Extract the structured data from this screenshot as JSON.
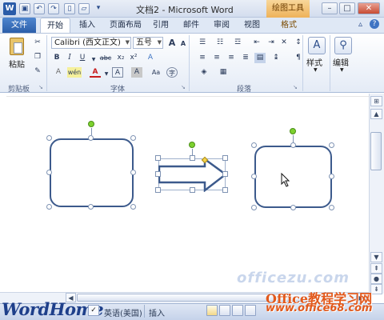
{
  "window": {
    "title": "文档2 - Microsoft Word",
    "contextual_tab": "绘图工具",
    "app_logo": "W",
    "quick_access": [
      "save-icon",
      "undo-icon",
      "redo-icon",
      "new-icon",
      "open-icon",
      "customize-icon"
    ],
    "controls": [
      "minimize",
      "maximize",
      "close"
    ]
  },
  "tabs": {
    "file": "文件",
    "home": "开始",
    "insert": "插入",
    "page_layout": "页面布局",
    "references": "引用",
    "mailings": "邮件",
    "review": "审阅",
    "view": "视图",
    "format": "格式"
  },
  "ribbon": {
    "clipboard": {
      "label": "剪贴板",
      "paste": "粘贴"
    },
    "font": {
      "label": "字体",
      "font_name": "Calibri (西文正文)",
      "font_size": "五号",
      "bold": "B",
      "italic": "I",
      "underline": "U",
      "strike": "abc",
      "subscript": "x₂",
      "superscript": "x²",
      "grow": "A",
      "shrink": "A",
      "case": "Aa",
      "clear": "A",
      "wen": "wén",
      "font_color": "A",
      "border_char": "A",
      "char_shading": "A",
      "enclose": "字"
    },
    "paragraph": {
      "label": "段落"
    },
    "styles": {
      "label": "样式"
    },
    "editing": {
      "label": "编辑"
    }
  },
  "statusbar": {
    "logo_text": "WordHome",
    "language": "英语(美国)",
    "insert_mode": "插入",
    "watermark_title": "Office教程学习网",
    "watermark_url": "www.office68.com",
    "watermark_faint": "officezu.com"
  },
  "colors": {
    "shape_outline": "#3c5a8c",
    "rotation_handle": "#7dd12f",
    "accent": "#2b5ea9",
    "contextual_tab": "#eeb25a"
  }
}
